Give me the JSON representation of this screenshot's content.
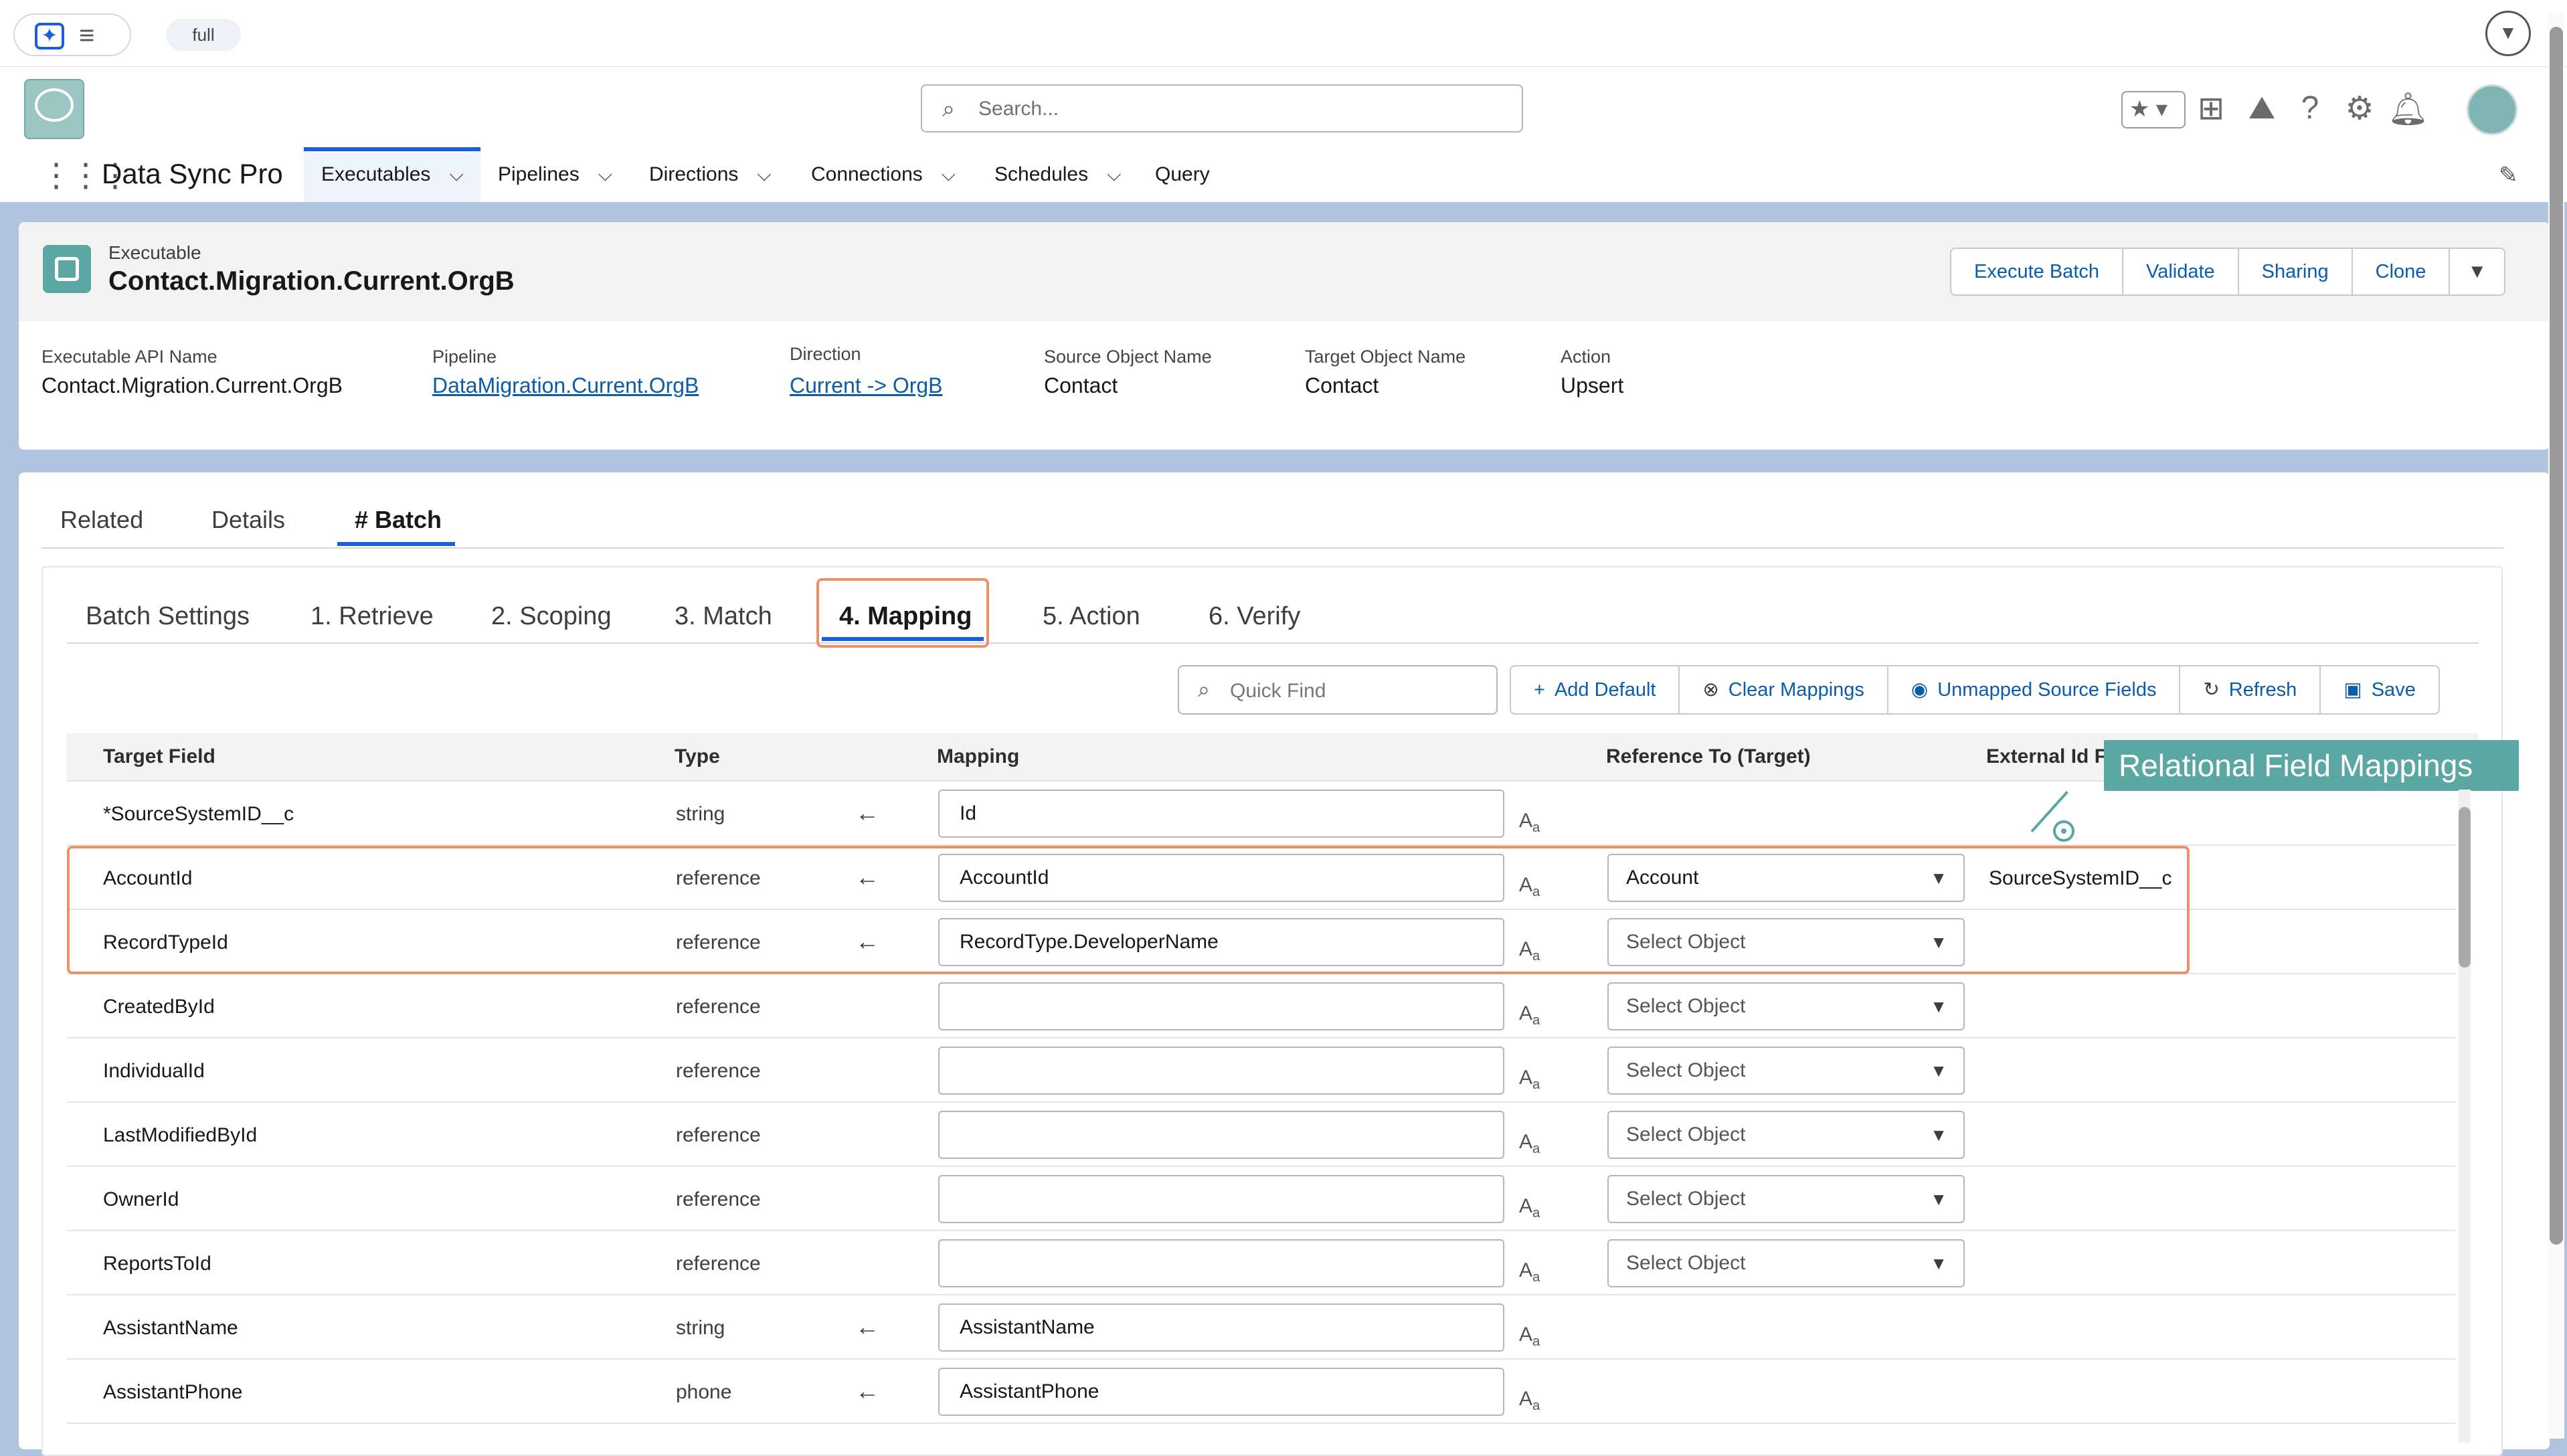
{
  "utility": {
    "env": "full"
  },
  "header": {
    "search_placeholder": "Search...",
    "app_name": "Data Sync Pro",
    "nav": [
      {
        "label": "Executables",
        "active": true
      },
      {
        "label": "Pipelines"
      },
      {
        "label": "Directions"
      },
      {
        "label": "Connections"
      },
      {
        "label": "Schedules"
      },
      {
        "label": "Query"
      }
    ]
  },
  "record": {
    "object_label": "Executable",
    "title": "Contact.Migration.Current.OrgB",
    "buttons": [
      "Execute Batch",
      "Validate",
      "Sharing",
      "Clone"
    ],
    "fields": [
      {
        "label": "Executable API Name",
        "value": "Contact.Migration.Current.OrgB",
        "link": false
      },
      {
        "label": "Pipeline",
        "value": "DataMigration.Current.OrgB",
        "link": true
      },
      {
        "label": "Direction",
        "value": "Current -> OrgB",
        "link": true
      },
      {
        "label": "Source Object Name",
        "value": "Contact",
        "link": false
      },
      {
        "label": "Target Object Name",
        "value": "Contact",
        "link": false
      },
      {
        "label": "Action",
        "value": "Upsert",
        "link": false
      }
    ]
  },
  "tabs": [
    "Related",
    "Details",
    "# Batch"
  ],
  "subtabs": [
    "Batch Settings",
    "1. Retrieve",
    "2. Scoping",
    "3. Match",
    "4. Mapping",
    "5. Action",
    "6. Verify"
  ],
  "toolbar": {
    "quickfind_placeholder": "Quick Find",
    "buttons": [
      "Add Default",
      "Clear Mappings",
      "Unmapped Source Fields",
      "Refresh",
      "Save"
    ]
  },
  "table": {
    "headers": [
      "Target Field",
      "Type",
      "Mapping",
      "Reference To (Target)",
      "External Id F"
    ],
    "rows": [
      {
        "field": "*SourceSystemID__c",
        "type": "string",
        "arrow": true,
        "mapping": "Id",
        "ref": null,
        "ext": ""
      },
      {
        "field": "AccountId",
        "type": "reference",
        "arrow": true,
        "mapping": "AccountId",
        "ref": "Account",
        "ext": "SourceSystemID__c"
      },
      {
        "field": "RecordTypeId",
        "type": "reference",
        "arrow": true,
        "mapping": "RecordType.DeveloperName",
        "ref": "Select Object",
        "ext": ""
      },
      {
        "field": "CreatedById",
        "type": "reference",
        "arrow": false,
        "mapping": "",
        "ref": "Select Object",
        "ext": ""
      },
      {
        "field": "IndividualId",
        "type": "reference",
        "arrow": false,
        "mapping": "",
        "ref": "Select Object",
        "ext": ""
      },
      {
        "field": "LastModifiedById",
        "type": "reference",
        "arrow": false,
        "mapping": "",
        "ref": "Select Object",
        "ext": ""
      },
      {
        "field": "OwnerId",
        "type": "reference",
        "arrow": false,
        "mapping": "",
        "ref": "Select Object",
        "ext": ""
      },
      {
        "field": "ReportsToId",
        "type": "reference",
        "arrow": false,
        "mapping": "",
        "ref": "Select Object",
        "ext": ""
      },
      {
        "field": "AssistantName",
        "type": "string",
        "arrow": true,
        "mapping": "AssistantName",
        "ref": null,
        "ext": ""
      },
      {
        "field": "AssistantPhone",
        "type": "phone",
        "arrow": true,
        "mapping": "AssistantPhone",
        "ref": null,
        "ext": ""
      }
    ]
  },
  "callout": {
    "text": "Relational Field Mappings"
  },
  "colors": {
    "brand": "#1b5fd9",
    "link": "#0b5cab",
    "highlight": "#e8936a",
    "callout": "#5aa7a4"
  }
}
